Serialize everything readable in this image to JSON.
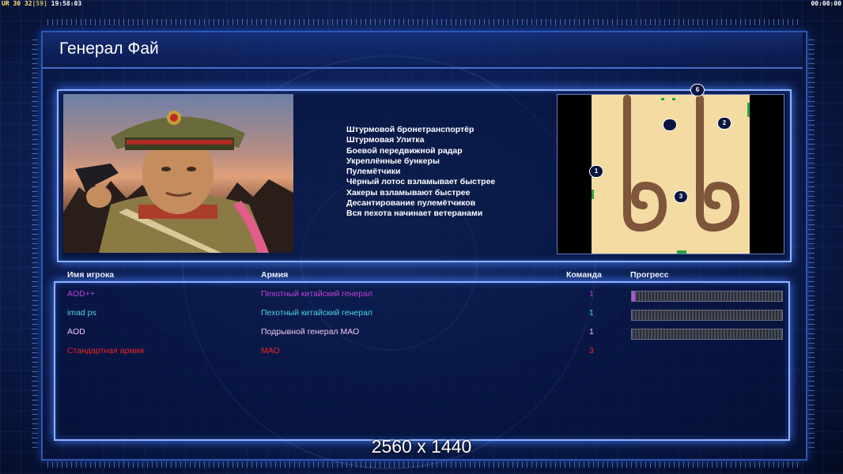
{
  "hud": {
    "ur": "UR",
    "tps": "30 32",
    "ping": "[59]",
    "clock": "19:58:03",
    "timer": "00:00:00"
  },
  "title": "Генерал Фай",
  "features": [
    "Штурмовой бронетранспортёр",
    "Штурмовая Улитка",
    "Боевой передвижной радар",
    "Укреплённые бункеры",
    "Пулемётчики",
    "Чёрный лотос взламывает быстрее",
    "Хакеры взламывают быстрее",
    "Десантирование пулемётчиков",
    "Вся пехота начинает ветеранами"
  ],
  "map": {
    "start_positions": [
      "1",
      "2",
      "3",
      "6"
    ]
  },
  "table": {
    "headers": {
      "name": "Имя игрока",
      "army": "Армия",
      "team": "Команда",
      "progress": "Прогресс"
    },
    "rows": [
      {
        "name": "AOD++",
        "army": "Пехотный китайский генерал",
        "team": "1",
        "color": "#c03ee0",
        "progress": 0.02
      },
      {
        "name": "imad ps",
        "army": "Пехотный китайский генерал",
        "team": "1",
        "color": "#47d6e6",
        "progress": 0
      },
      {
        "name": "AOD",
        "army": "Подрывной генерал МАО",
        "team": "1",
        "color": "#f0c8f4",
        "progress": 0
      },
      {
        "name": "Стандартная армия",
        "army": "МАО",
        "team": "3",
        "color": "#ee2222",
        "progress": null
      }
    ]
  },
  "resolution": "2560 x 1440",
  "colors": {
    "frame": "#8fb4ff",
    "background": "#0e2258"
  }
}
